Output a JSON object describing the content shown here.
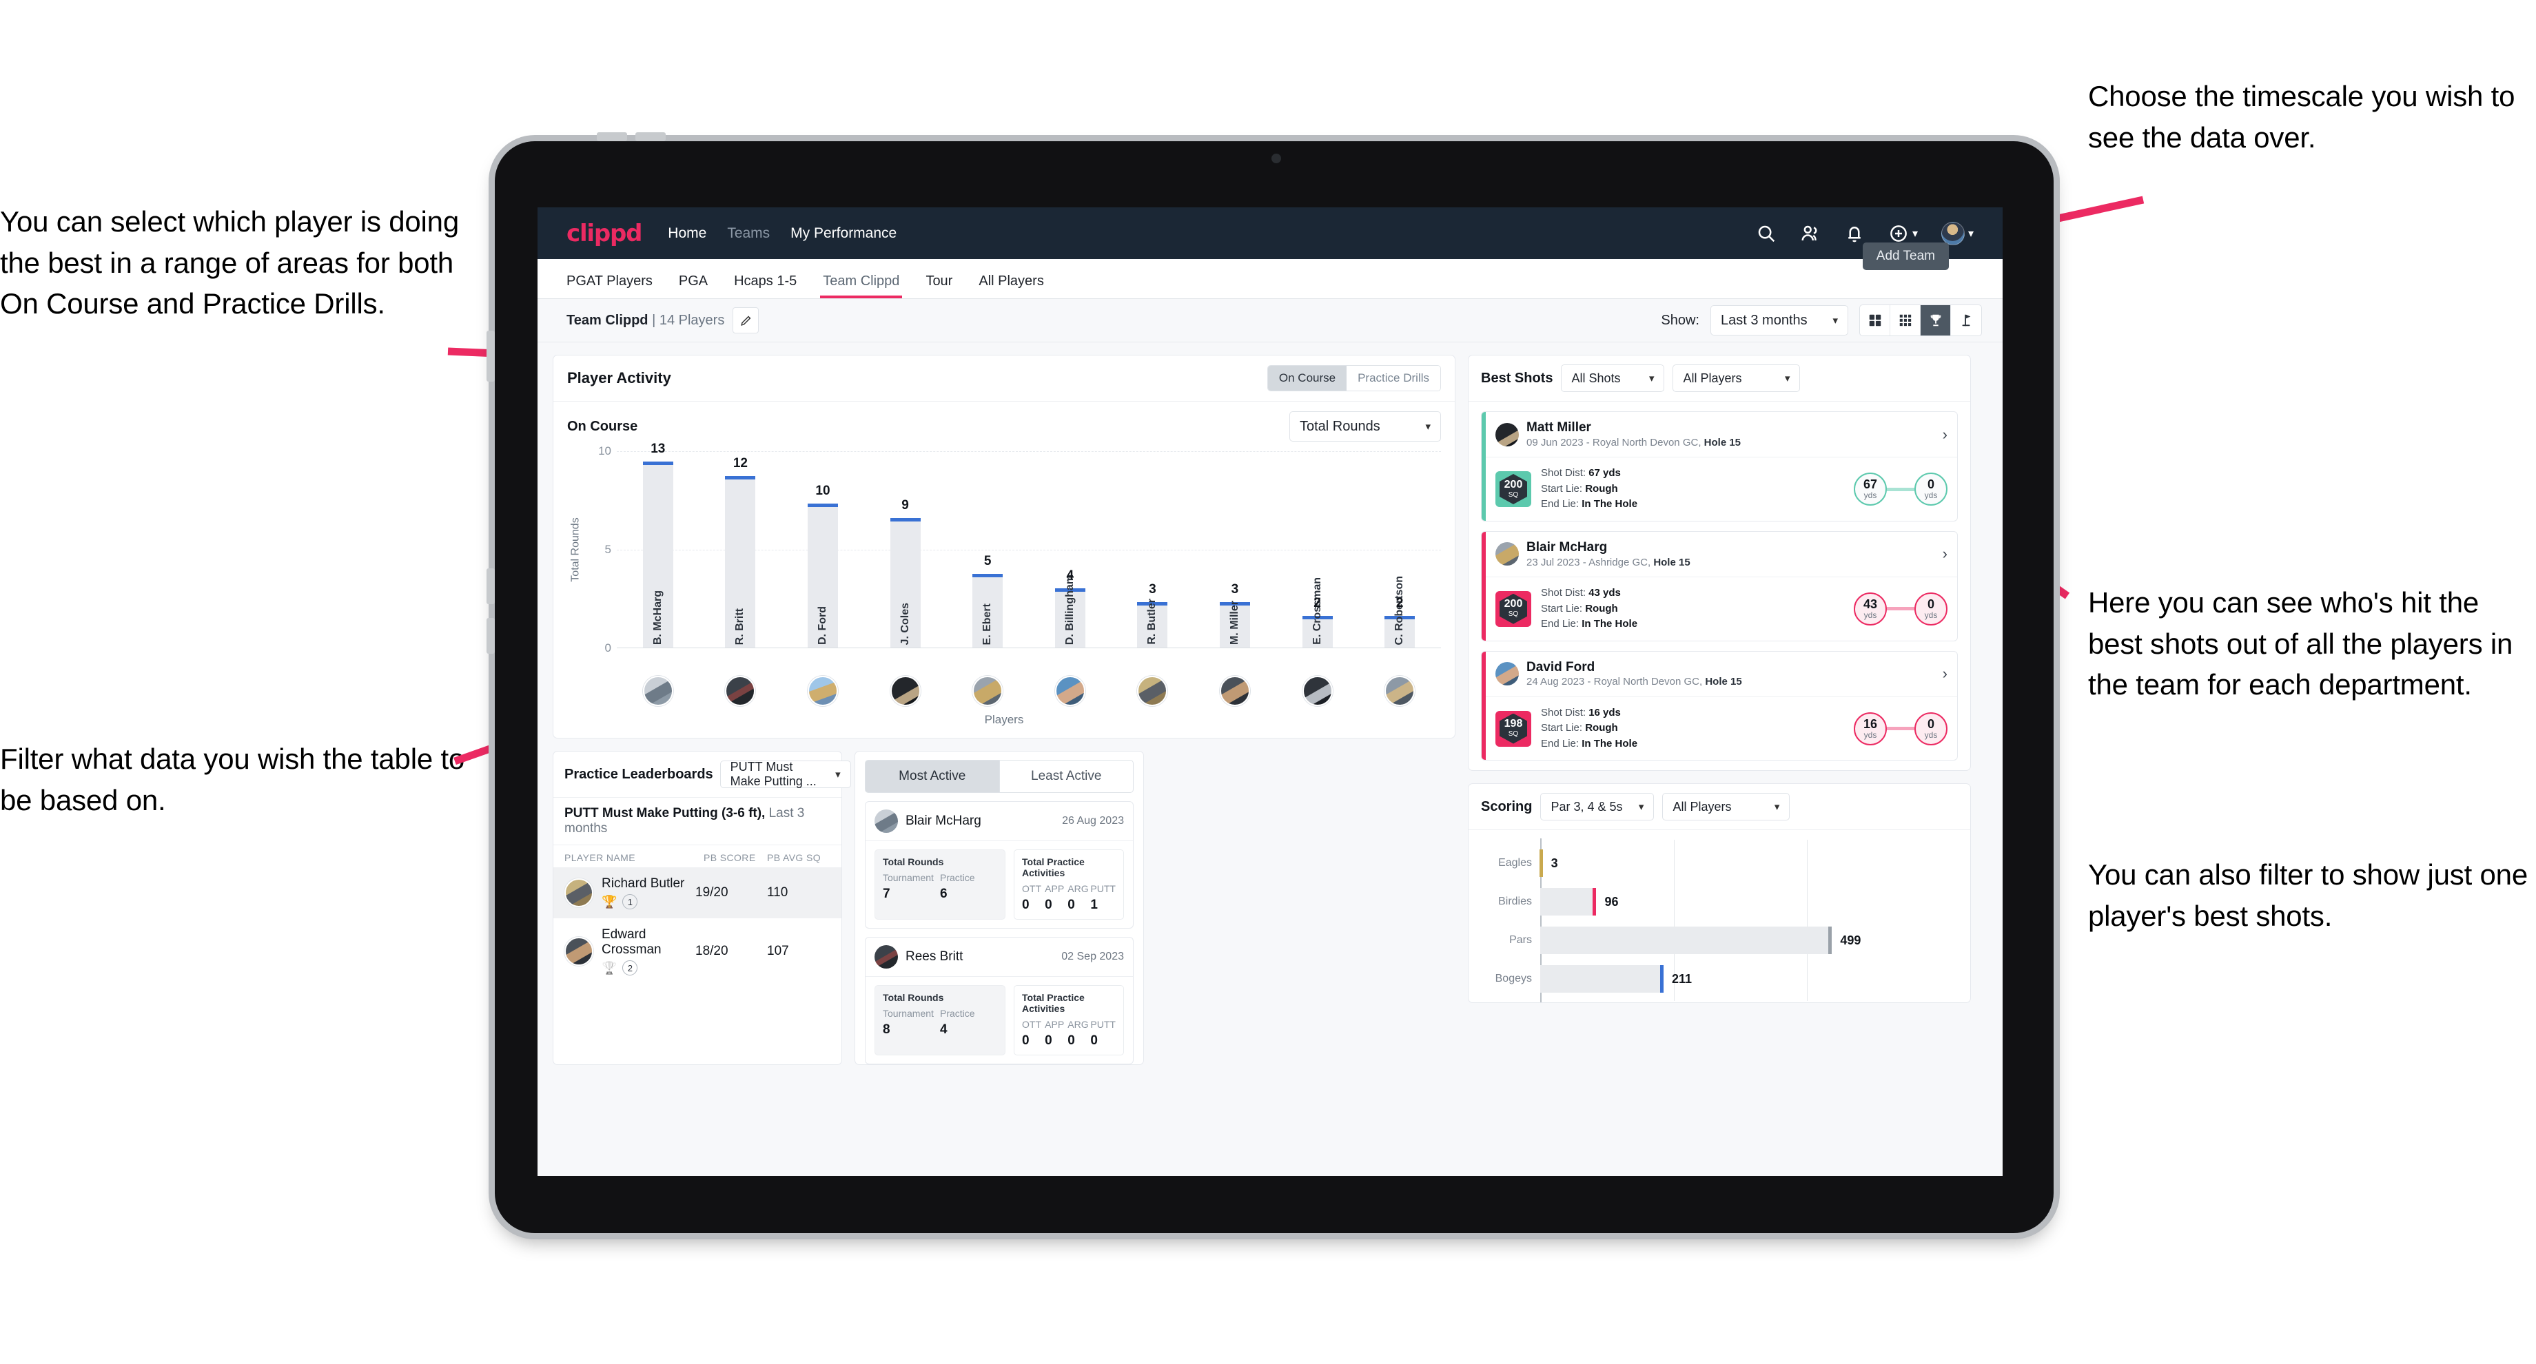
{
  "annotations": {
    "left_top": "You can select which player is doing the best in a range of areas for both On Course and Practice Drills.",
    "left_bottom": "Filter what data you wish the table to be based on.",
    "right_top": "Choose the timescale you wish to see the data over.",
    "right_middle": "Here you can see who's hit the best shots out of all the players in the team for each department.",
    "right_bottom": "You can also filter to show just one player's best shots."
  },
  "topnav": {
    "logo": "clippd",
    "links": [
      {
        "label": "Home",
        "active": true
      },
      {
        "label": "Teams",
        "active": false
      },
      {
        "label": "My Performance",
        "active": true
      }
    ],
    "icons": [
      "search-icon",
      "people-icon",
      "bell-icon",
      "plus-circle-icon"
    ],
    "avatar": "user-avatar"
  },
  "tabs": [
    {
      "label": "PGAT Players",
      "active": false
    },
    {
      "label": "PGA",
      "active": false
    },
    {
      "label": "Hcaps 1-5",
      "active": false
    },
    {
      "label": "Team Clippd",
      "active": true
    },
    {
      "label": "Tour",
      "active": false
    },
    {
      "label": "All Players",
      "active": false
    }
  ],
  "tooltip": "Add Team",
  "subbar": {
    "team_name": "Team Clippd",
    "team_sep": " | ",
    "player_count": "14 Players",
    "show_label": "Show:",
    "timescale": "Last 3 months",
    "views": [
      {
        "name": "grid-large-icon",
        "active": false
      },
      {
        "name": "grid-small-icon",
        "active": false
      },
      {
        "name": "trophy-icon",
        "active": true
      },
      {
        "name": "flag-icon",
        "active": false
      }
    ]
  },
  "player_activity": {
    "title": "Player Activity",
    "segments": [
      {
        "label": "On Course",
        "active": true
      },
      {
        "label": "Practice Drills",
        "active": false
      }
    ],
    "sub_label": "On Course",
    "metric": "Total Rounds"
  },
  "best_shots": {
    "title": "Best Shots",
    "filter_shots": "All Shots",
    "filter_players": "All Players",
    "cards": [
      {
        "player": "Matt Miller",
        "date": "09 Jun 2023",
        "course": "Royal North Devon GC,",
        "hole": "Hole 15",
        "sq": "200",
        "sq_unit": "SQ",
        "shot_dist_label": "Shot Dist:",
        "shot_dist": "67 yds",
        "start_lie_label": "Start Lie:",
        "start_lie": "Rough",
        "end_lie_label": "End Lie:",
        "end_lie": "In The Hole",
        "from_val": "67",
        "from_unit": "yds",
        "to_val": "0",
        "to_unit": "yds",
        "accent": "teal"
      },
      {
        "player": "Blair McHarg",
        "date": "23 Jul 2023",
        "course": "Ashridge GC,",
        "hole": "Hole 15",
        "sq": "200",
        "sq_unit": "SQ",
        "shot_dist_label": "Shot Dist:",
        "shot_dist": "43 yds",
        "start_lie_label": "Start Lie:",
        "start_lie": "Rough",
        "end_lie_label": "End Lie:",
        "end_lie": "In The Hole",
        "from_val": "43",
        "from_unit": "yds",
        "to_val": "0",
        "to_unit": "yds",
        "accent": "pink"
      },
      {
        "player": "David Ford",
        "date": "24 Aug 2023",
        "course": "Royal North Devon GC,",
        "hole": "Hole 15",
        "sq": "198",
        "sq_unit": "SQ",
        "shot_dist_label": "Shot Dist:",
        "shot_dist": "16 yds",
        "start_lie_label": "Start Lie:",
        "start_lie": "Rough",
        "end_lie_label": "End Lie:",
        "end_lie": "In The Hole",
        "from_val": "16",
        "from_unit": "yds",
        "to_val": "0",
        "to_unit": "yds",
        "accent": "pink"
      }
    ]
  },
  "practice_leaderboards": {
    "title": "Practice Leaderboards",
    "drill_select": "PUTT Must Make Putting ...",
    "subtitle_bold": "PUTT Must Make Putting (3-6 ft),",
    "subtitle_rest": " Last 3 months",
    "columns": [
      "PLAYER NAME",
      "PB SCORE",
      "PB AVG SQ"
    ],
    "rows": [
      {
        "name": "Richard Butler",
        "rank": "1",
        "trophy": "gold",
        "pb_score": "19/20",
        "pb_avg_sq": "110",
        "highlight": true
      },
      {
        "name": "Edward Crossman",
        "rank": "2",
        "trophy": "silver",
        "pb_score": "18/20",
        "pb_avg_sq": "107",
        "highlight": false
      }
    ]
  },
  "activity": {
    "tabs": [
      {
        "label": "Most Active",
        "active": true
      },
      {
        "label": "Least Active",
        "active": false
      }
    ],
    "rounds_header": "Total Rounds",
    "rounds_keys": [
      "Tournament",
      "Practice"
    ],
    "practice_header": "Total Practice Activities",
    "practice_keys": [
      "OTT",
      "APP",
      "ARG",
      "PUTT"
    ],
    "cards": [
      {
        "player": "Blair McHarg",
        "date": "26 Aug 2023",
        "rounds": [
          "7",
          "6"
        ],
        "practice": [
          "0",
          "0",
          "0",
          "1"
        ]
      },
      {
        "player": "Rees Britt",
        "date": "02 Sep 2023",
        "rounds": [
          "8",
          "4"
        ],
        "practice": [
          "0",
          "0",
          "0",
          "0"
        ]
      }
    ]
  },
  "scoring": {
    "title": "Scoring",
    "filter_par": "Par 3, 4 & 5s",
    "filter_players": "All Players"
  },
  "colors": {
    "brand_pink": "#ec2a62",
    "nav_dark": "#1b2735",
    "bar_blue": "#3971d4",
    "teal": "#5cc9ad",
    "annotation_arrow": "#ec2a62"
  },
  "chart_data": [
    {
      "type": "bar",
      "title": "Player Activity",
      "xlabel": "Players",
      "ylabel": "Total Rounds",
      "ylim": [
        0,
        14
      ],
      "yticks": [
        0,
        5,
        10
      ],
      "grid": true,
      "categories": [
        "B. McHarg",
        "R. Britt",
        "D. Ford",
        "J. Coles",
        "E. Ebert",
        "D. Billingham",
        "R. Butler",
        "M. Miller",
        "E. Crossman",
        "C. Robertson"
      ],
      "values": [
        13,
        12,
        10,
        9,
        5,
        4,
        3,
        3,
        2,
        2
      ],
      "legend": []
    },
    {
      "type": "bar",
      "orientation": "horizontal",
      "title": "Scoring",
      "xlabel": "",
      "ylabel": "",
      "xlim": [
        0,
        600
      ],
      "grid": true,
      "categories": [
        "Eagles",
        "Birdies",
        "Pars",
        "Bogeys"
      ],
      "values": [
        3,
        96,
        499,
        211
      ],
      "cap_colors": [
        "#c9a94e",
        "#ec2a62",
        "#9aa1a9",
        "#3971d4"
      ]
    }
  ]
}
